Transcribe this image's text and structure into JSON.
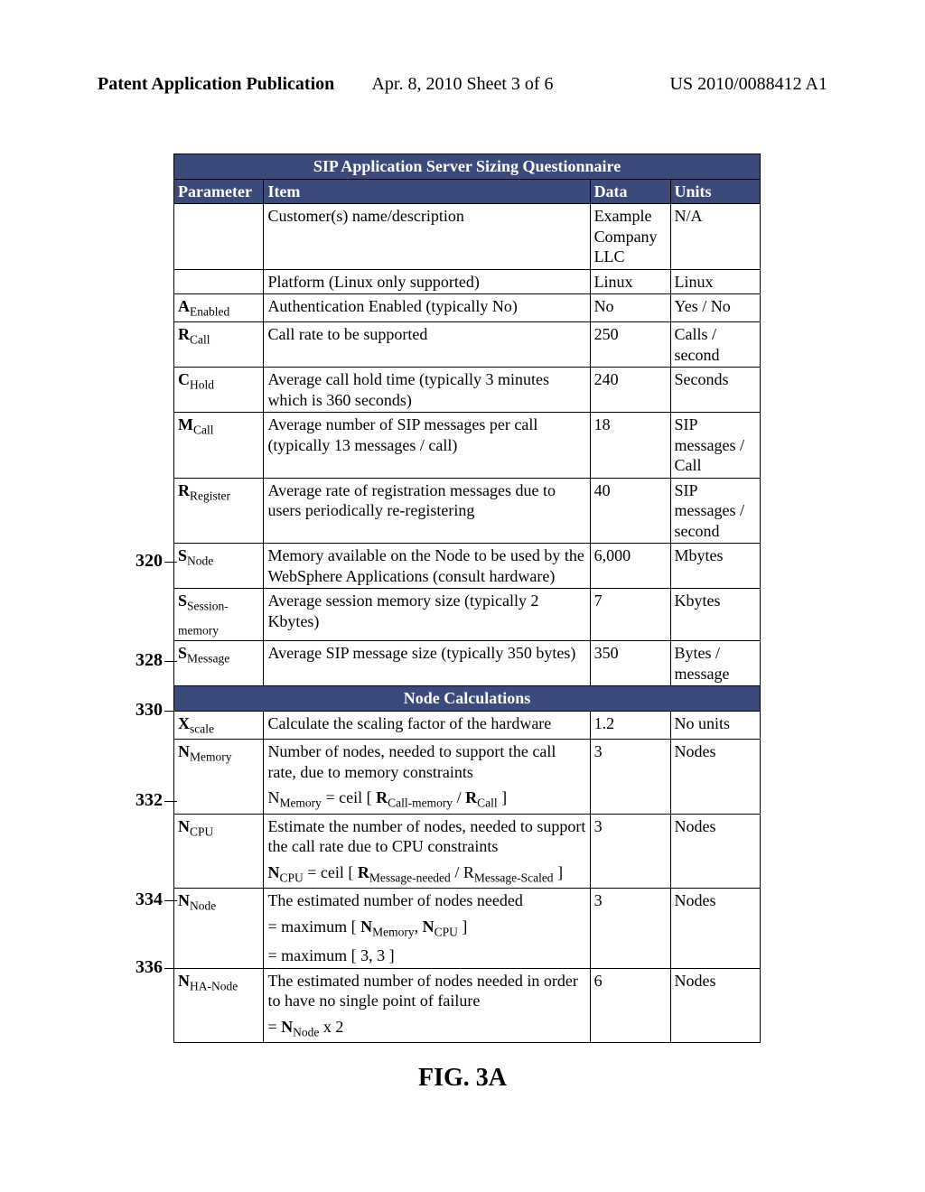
{
  "header": {
    "left": "Patent Application Publication",
    "center": "Apr. 8, 2010  Sheet 3 of 6",
    "right": "US 2010/0088412 A1"
  },
  "figure_label": "FIG. 3A",
  "callouts": {
    "c320": "320",
    "c328": "328",
    "c330": "330",
    "c332": "332",
    "c334": "334",
    "c336": "336"
  },
  "table": {
    "title": "SIP Application Server Sizing Questionnaire",
    "cols": {
      "parameter": "Parameter",
      "item": "Item",
      "data": "Data",
      "units": "Units"
    },
    "section2": "Node Calculations",
    "rows": [
      {
        "p_main": "",
        "p_sub": "",
        "item": "Customer(s) name/description",
        "data": "Example Company LLC",
        "units": "N/A"
      },
      {
        "p_main": "",
        "p_sub": "",
        "item": "Platform (Linux only supported)",
        "data": "Linux",
        "units": "Linux"
      },
      {
        "p_main": "A",
        "p_sub": "Enabled",
        "item": "Authentication Enabled (typically No)",
        "data": "No",
        "units": "Yes / No"
      },
      {
        "p_main": "R",
        "p_sub": "Call",
        "item": "Call rate to be supported",
        "data": "250",
        "units": "Calls / second"
      },
      {
        "p_main": "C",
        "p_sub": "Hold",
        "item": "Average call hold time (typically 3 minutes which is 360 seconds)",
        "data": "240",
        "units": "Seconds"
      },
      {
        "p_main": "M",
        "p_sub": "Call",
        "item": "Average number of SIP messages per call (typically 13 messages / call)",
        "data": "18",
        "units": "SIP messages / Call"
      },
      {
        "p_main": "R",
        "p_sub": "Register",
        "item": "Average rate of registration messages due to users periodically re-registering",
        "data": "40",
        "units": "SIP messages / second"
      },
      {
        "p_main": "S",
        "p_sub": "Node",
        "item": "Memory available on the Node to be used by the WebSphere Applications (consult hardware)",
        "data": "6,000",
        "units": "Mbytes"
      },
      {
        "p_main": "S",
        "p_sub": "Session-memory",
        "item": "Average session memory size (typically 2 Kbytes)",
        "data": "7",
        "units": "Kbytes"
      },
      {
        "p_main": "S",
        "p_sub": "Message",
        "item": "Average SIP message size (typically 350 bytes)",
        "data": "350",
        "units": "Bytes / message"
      }
    ],
    "calc": {
      "xscale": {
        "p_main": "X",
        "p_sub": "scale",
        "item": "Calculate the scaling factor of the hardware",
        "data": "1.2",
        "units": "No units"
      },
      "nmemory": {
        "p_main": "N",
        "p_sub": "Memory",
        "item": "Number of nodes, needed to support the call rate, due to memory constraints",
        "data": "3",
        "units": "Nodes",
        "f_pre": "N",
        "f_s1": "Memory",
        "f_mid": " = ceil [ ",
        "f_b1": "R",
        "f_s2": "Call-memory",
        "f_mid2": " / ",
        "f_b2": "R",
        "f_s3": "Call",
        "f_end": " ]"
      },
      "ncpu": {
        "p_main": "N",
        "p_sub": "CPU",
        "item": "Estimate the number of nodes, needed to support the call rate due to CPU constraints",
        "data": "3",
        "units": "Nodes",
        "f_pre": "N",
        "f_s1": "CPU",
        "f_mid": " = ceil [ ",
        "f_b1": "R",
        "f_s2": "Message-needed",
        "f_mid2": " / ",
        "f_l2": "R",
        "f_s3": "Message-Scaled",
        "f_end": " ]"
      },
      "nnode": {
        "p_main": "N",
        "p_sub": "Node",
        "item": "The estimated number of nodes needed",
        "data": "3",
        "units": "Nodes",
        "f2a": "= maximum [ ",
        "f2b": "N",
        "f2s1": "Memory",
        "f2c": ", ",
        "f2d": "N",
        "f2s2": "CPU",
        "f2e": " ]",
        "f3": "= maximum [ 3, 3 ]"
      },
      "nha": {
        "p_main": "N",
        "p_sub": "HA-Node",
        "item": "The estimated number of nodes needed in order to have no single point of failure",
        "data": "6",
        "units": "Nodes",
        "f_pre": "= ",
        "f_b": "N",
        "f_s": "Node",
        "f_end": " x 2"
      }
    }
  }
}
